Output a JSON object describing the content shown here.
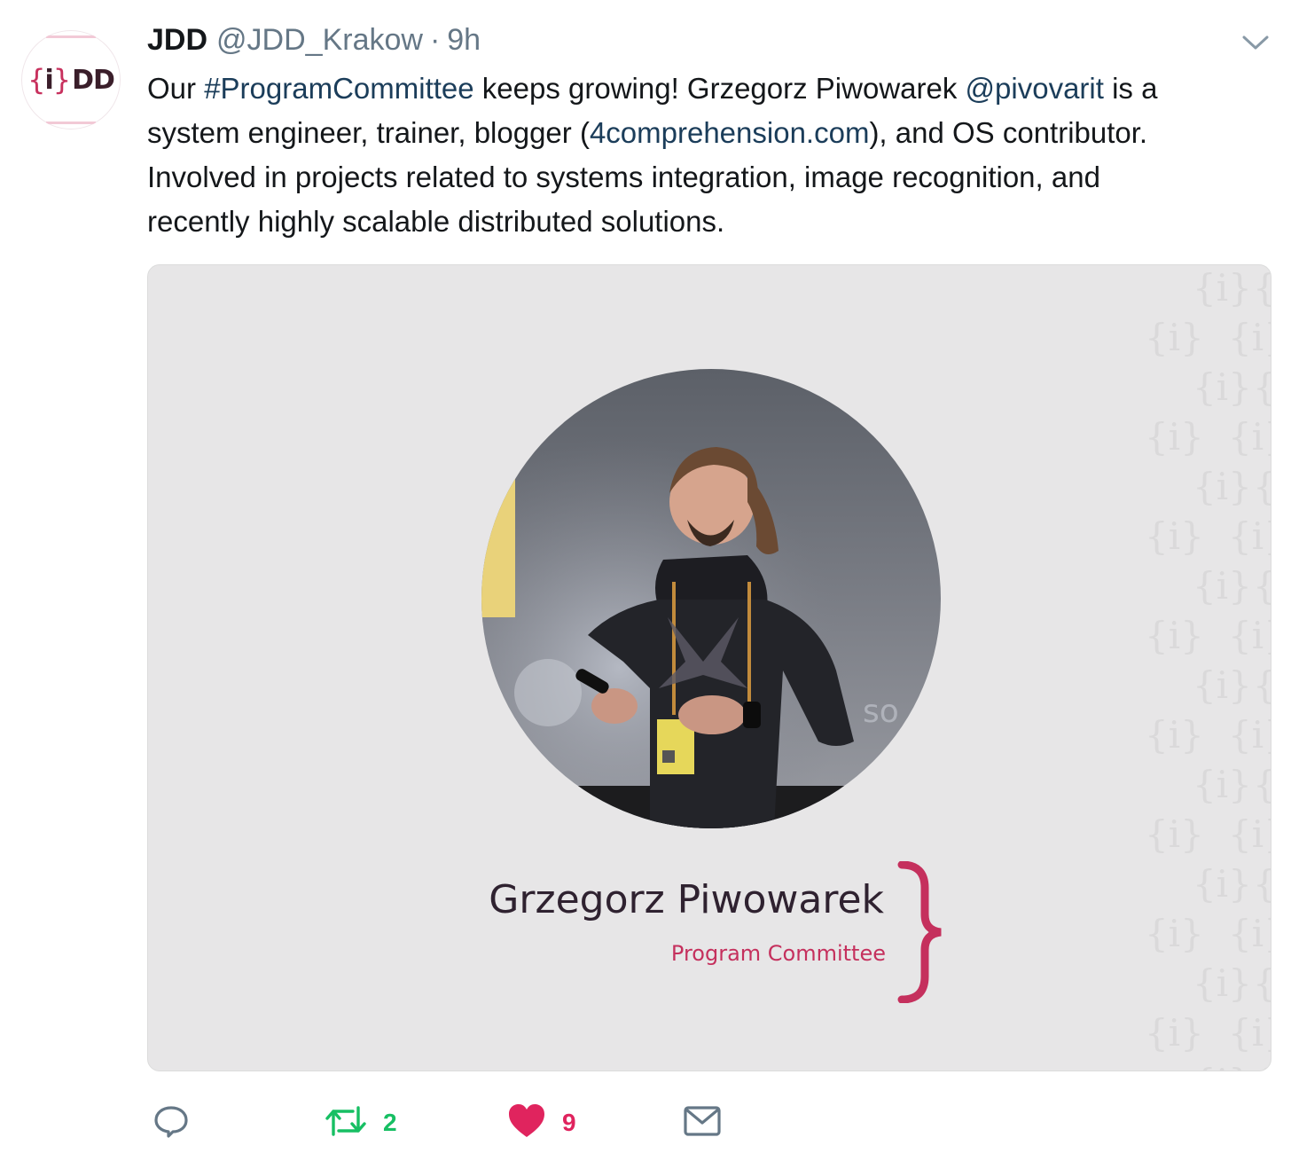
{
  "tweet": {
    "author_name": "JDD",
    "author_handle": "@JDD_Krakow",
    "separator": "·",
    "time": "9h",
    "avatar_logo": {
      "left_brace": "{",
      "mid": "i",
      "right_brace": "}",
      "letters": "DD"
    },
    "text_lines": [
      {
        "parts": [
          {
            "t": "Our ",
            "link": false
          },
          {
            "t": "#ProgramCommittee",
            "link": true
          },
          {
            "t": " keeps growing! Grzegorz Piwowarek ",
            "link": false
          },
          {
            "t": "@pivovarit",
            "link": true
          },
          {
            "t": " is a",
            "link": false
          }
        ]
      },
      {
        "parts": [
          {
            "t": "system engineer,  trainer, blogger (",
            "link": false
          },
          {
            "t": "4comprehension.com",
            "link": true
          },
          {
            "t": "), and OS contributor.",
            "link": false
          }
        ]
      },
      {
        "parts": [
          {
            "t": "Involved in projects related to systems integration, image recognition, and",
            "link": false
          }
        ]
      },
      {
        "parts": [
          {
            "t": "recently highly scalable distributed solutions.",
            "link": false
          }
        ]
      }
    ]
  },
  "media_card": {
    "person_name": "Grzegorz Piwowarek",
    "role": "Program Committee",
    "photo_alt_semantic": "speaker-photo"
  },
  "actions": {
    "reply_count": "",
    "retweet_count": "2",
    "like_count": "9"
  },
  "colors": {
    "link": "#1b3d5a",
    "retweet": "#17bf63",
    "like": "#e0245e",
    "brand_pink": "#c5305d",
    "muted": "#657786"
  }
}
